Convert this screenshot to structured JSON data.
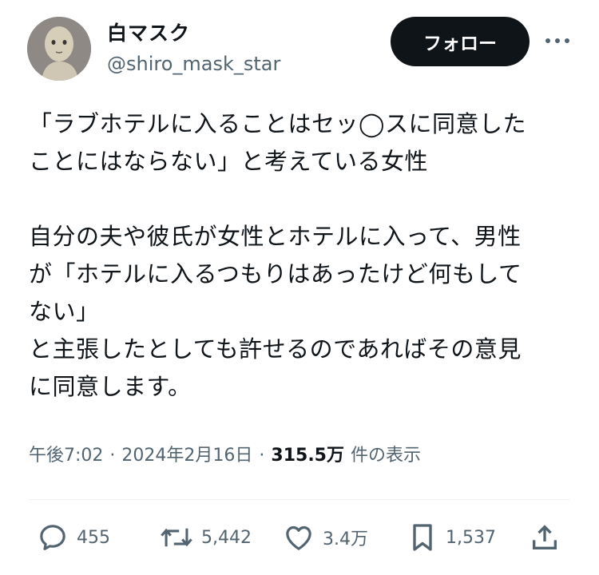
{
  "author": {
    "name": "白マスク",
    "handle": "@shiro_mask_star",
    "avatar_icon": "avatar-illustration-icon"
  },
  "header": {
    "follow_label": "フォロー",
    "more_icon": "more-horizontal-icon"
  },
  "tweet": {
    "lines": [
      "「ラブホテルに入ることはセッ◯スに同意した",
      "ことにはならない」と考えている女性",
      "",
      "自分の夫や彼氏が女性とホテルに入って、男性",
      "が「ホテルに入るつもりはあったけど何もして",
      "ない」",
      "と主張したとしても許せるのであればその意見",
      "に同意します。"
    ]
  },
  "meta": {
    "time": "午後7:02",
    "separator": "·",
    "date": "2024年2月16日",
    "views": "315.5万",
    "views_label": "件の表示"
  },
  "actions": {
    "replies": "455",
    "retweets": "5,442",
    "likes": "3.4万",
    "bookmarks": "1,537",
    "icons": [
      "reply-icon",
      "retweet-icon",
      "like-icon",
      "bookmark-icon",
      "share-icon"
    ]
  },
  "colors": {
    "text": "#0f1419",
    "secondary": "#536471",
    "button": "#0f1419",
    "divider": "#eff3f4"
  }
}
